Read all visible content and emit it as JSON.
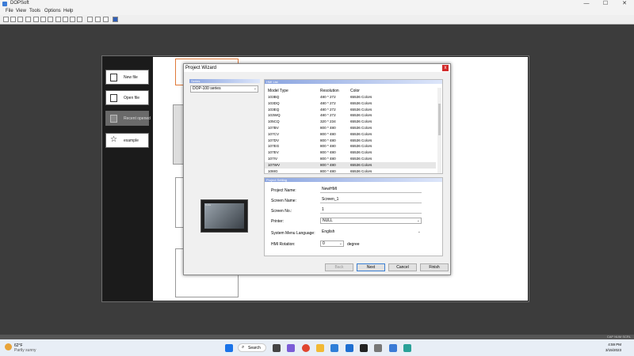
{
  "app": {
    "title": "DOPSoft"
  },
  "window_controls": {
    "minimize": "—",
    "maximize": "☐",
    "close": "✕"
  },
  "menu": [
    "File",
    "View",
    "Tools",
    "Options",
    "Help"
  ],
  "start_panel": {
    "items": [
      {
        "label": "New file",
        "icon": "new-file-icon"
      },
      {
        "label": "Open file",
        "icon": "open-file-icon"
      },
      {
        "label": "Recent opened",
        "icon": "recent-icon",
        "selected": true
      },
      {
        "label": "example",
        "icon": "star-icon"
      }
    ]
  },
  "dialog": {
    "title": "Project Wizard",
    "close": "x",
    "series_header": "Series",
    "series_value": "DOP-100 series",
    "hmi_header": "HMI List",
    "hmi_image_label": "Delta",
    "list_headers": {
      "model": "Model Type",
      "resolution": "Resolution",
      "color": "Color"
    },
    "models": [
      {
        "model": "103BQ",
        "resolution": "480 * 272",
        "color": "65536 Colors"
      },
      {
        "model": "103DQ",
        "resolution": "480 * 272",
        "color": "65536 Colors"
      },
      {
        "model": "103EQ",
        "resolution": "480 * 272",
        "color": "65536 Colors"
      },
      {
        "model": "103WQ",
        "resolution": "480 * 272",
        "color": "65536 Colors"
      },
      {
        "model": "105CQ",
        "resolution": "320 * 234",
        "color": "65536 Colors"
      },
      {
        "model": "107BV",
        "resolution": "800 * 480",
        "color": "65536 Colors"
      },
      {
        "model": "107CV",
        "resolution": "800 * 480",
        "color": "65536 Colors"
      },
      {
        "model": "107DV",
        "resolution": "800 * 480",
        "color": "65536 Colors"
      },
      {
        "model": "107EG",
        "resolution": "800 * 480",
        "color": "65536 Colors"
      },
      {
        "model": "107EV",
        "resolution": "800 * 480",
        "color": "65536 Colors"
      },
      {
        "model": "107IV",
        "resolution": "800 * 480",
        "color": "65536 Colors"
      },
      {
        "model": "107WV",
        "resolution": "800 * 480",
        "color": "65536 Colors",
        "selected": true
      },
      {
        "model": "108IG",
        "resolution": "800 * 480",
        "color": "65536 Colors"
      }
    ],
    "setting_header": "Project Setting",
    "fields": {
      "project_name_label": "Project Name:",
      "project_name_value": "NewHMI",
      "screen_name_label": "Screen Name:",
      "screen_name_value": "Screen_1",
      "screen_no_label": "Screen No.:",
      "screen_no_value": "1",
      "printer_label": "Printer:",
      "printer_value": "NULL",
      "language_label": "System Menu Language:",
      "language_value": "English",
      "rotation_label": "HMI Rotation:",
      "rotation_value": "0",
      "rotation_unit": "degree"
    },
    "buttons": {
      "back": "Back",
      "next": "Next",
      "cancel": "Cancel",
      "finish": "Finish"
    }
  },
  "status": {
    "right": "CAP NUM SCRL"
  },
  "taskbar": {
    "weather_temp": "62°F",
    "weather_cond": "Partly sunny",
    "search": "Search",
    "time": "4:59 PM",
    "date": "3/15/2023"
  }
}
